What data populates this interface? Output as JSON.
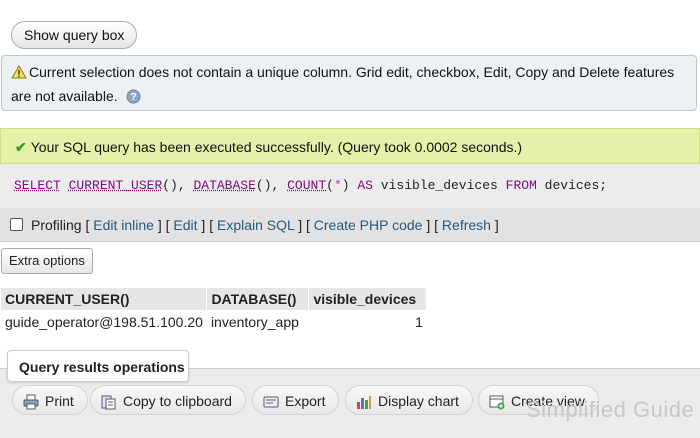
{
  "show_query_box": "Show query box",
  "notice": {
    "text": "Current selection does not contain a unique column. Grid edit, checkbox, Edit, Copy and Delete features are not available."
  },
  "success": {
    "text": "Your SQL query has been executed successfully. (Query took 0.0002 seconds.)"
  },
  "sql": {
    "select": "SELECT",
    "func1": "CURRENT_USER",
    "paren1": "(), ",
    "func2": "DATABASE",
    "paren2": "(), ",
    "func3": "COUNT",
    "open": "(",
    "star": "*",
    "close": ")",
    "as": "AS",
    "alias": "visible_devices",
    "from": "FROM",
    "table": "devices;"
  },
  "links": {
    "profiling": "Profiling",
    "edit_inline": "Edit inline",
    "edit": "Edit",
    "explain_sql": "Explain SQL",
    "create_php": "Create PHP code",
    "refresh": "Refresh"
  },
  "extra_options": "Extra options",
  "results": {
    "headers": [
      "CURRENT_USER()",
      "DATABASE()",
      "visible_devices"
    ],
    "rows": [
      [
        "guide_operator@198.51.100.20",
        "inventory_app",
        "1"
      ]
    ]
  },
  "operations": {
    "title": "Query results operations",
    "print": "Print",
    "copy": "Copy to clipboard",
    "export": "Export",
    "display_chart": "Display chart",
    "create_view": "Create view"
  },
  "watermark": "Simplified Guide",
  "colors": {
    "success_bg": "#e6f0a9",
    "link": "#235a81",
    "sql_keyword": "#7b0a7b"
  }
}
